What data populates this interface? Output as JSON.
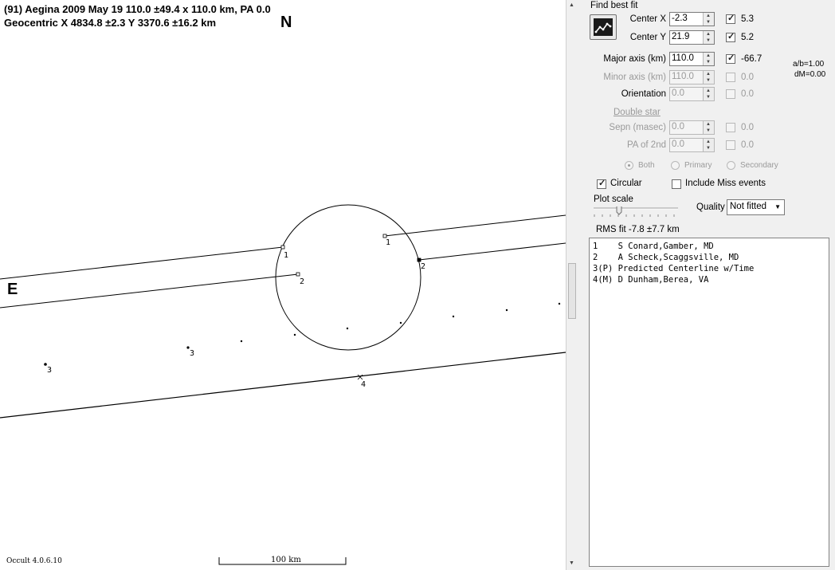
{
  "plot": {
    "header_line1": "(91) Aegina  2009 May 19  110.0 ±49.4 x 110.0 km, PA 0.0",
    "header_line2": "Geocentric  X 4834.8 ±2.3  Y 3370.6 ±16.2 km",
    "north_label": "N",
    "east_label": "E",
    "version": "Occult 4.0.6.10",
    "scale_label": "100 km",
    "chord_labels": [
      "1",
      "2",
      "1",
      "2",
      "3",
      "3",
      "4"
    ]
  },
  "panel": {
    "title": "Find best fit",
    "fit_button_icon": "fit-graph-icon",
    "center_x": {
      "label": "Center X",
      "value": "-2.3",
      "checked": true,
      "result": "5.3"
    },
    "center_y": {
      "label": "Center Y",
      "value": "21.9",
      "checked": true,
      "result": "5.2"
    },
    "major_axis": {
      "label": "Major axis (km)",
      "value": "110.0",
      "checked": true,
      "result": "-66.7"
    },
    "minor_axis": {
      "label": "Minor axis (km)",
      "value": "110.0",
      "checked": false,
      "result": "0.0"
    },
    "orientation": {
      "label": "Orientation",
      "value": "0.0",
      "checked": false,
      "result": "0.0"
    },
    "ab_ratio": "a/b=1.00",
    "dm": "dM=0.00",
    "double_star": {
      "title": "Double star",
      "sepn": {
        "label": "Sepn (masec)",
        "value": "0.0",
        "result": "0.0"
      },
      "pa2": {
        "label": "PA of 2nd",
        "value": "0.0",
        "result": "0.0"
      },
      "radios": [
        "Both",
        "Primary",
        "Secondary"
      ],
      "selected": "Both"
    },
    "circular_label": "Circular",
    "circular_checked": true,
    "include_miss_label": "Include Miss events",
    "include_miss_checked": false,
    "plot_scale_label": "Plot scale",
    "quality_label": "Quality",
    "quality_value": "Not fitted",
    "rms_fit": "RMS fit -7.8 ±7.7 km",
    "observers": [
      "1    S Conard,Gamber, MD",
      "2    A Scheck,Scaggsville, MD",
      "3(P) Predicted Centerline w/Time",
      "4(M) D Dunham,Berea, VA"
    ]
  }
}
